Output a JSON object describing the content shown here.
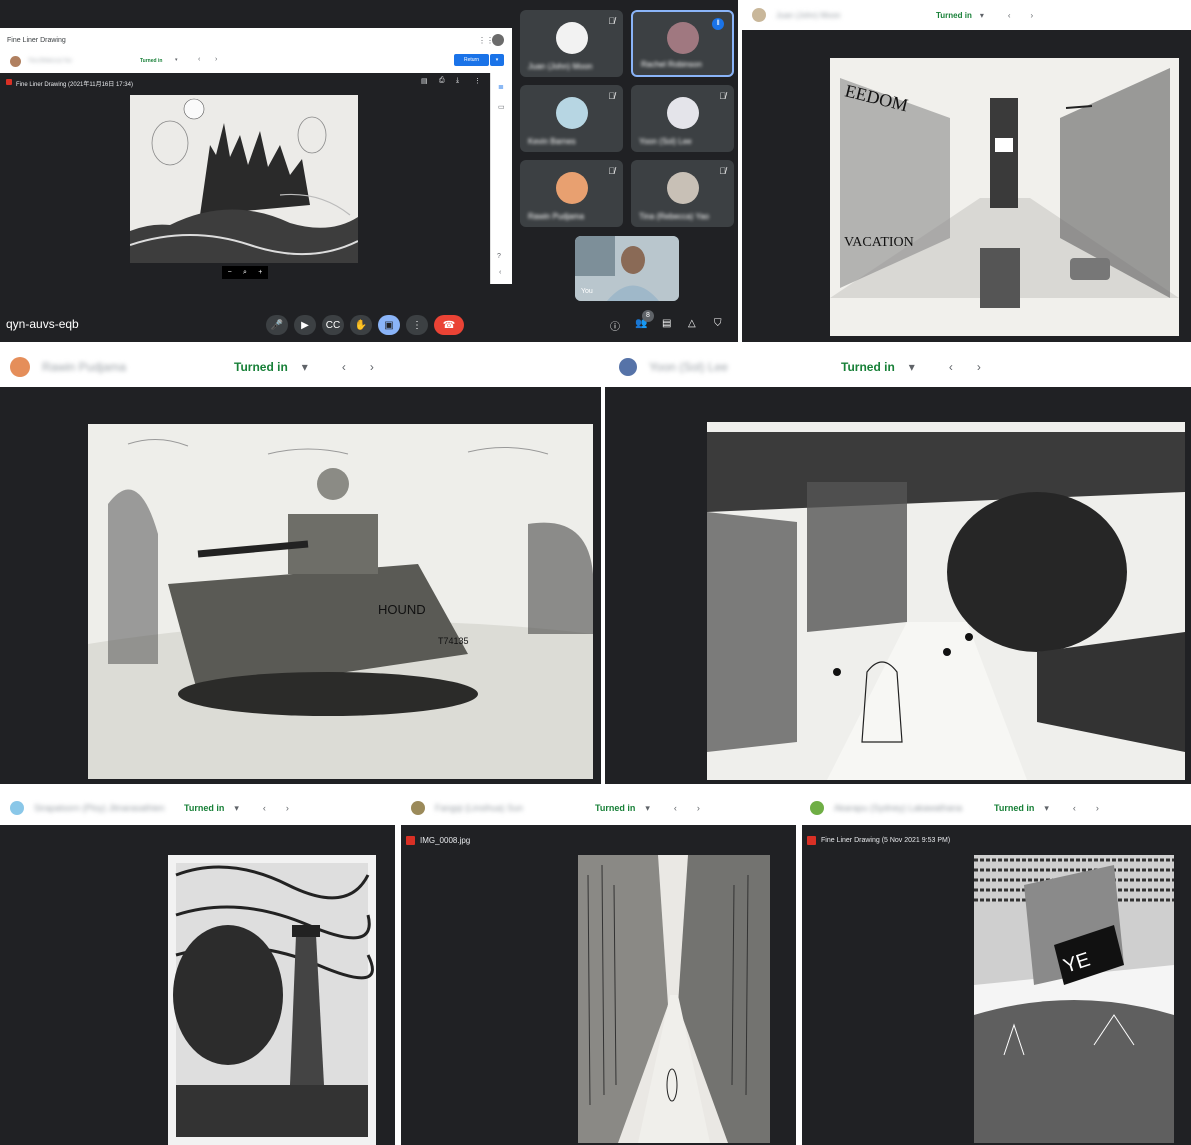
{
  "meet": {
    "meeting_code": "qyn-auvs-eqb",
    "people_count": "8",
    "self_label": "You",
    "participants": [
      {
        "name": "Juan (John) Moon"
      },
      {
        "name": "Rachel Robinson"
      },
      {
        "name": "Kevin Barnes"
      },
      {
        "name": "Yoon (Sol) Lee"
      },
      {
        "name": "Rawin Pudjama"
      },
      {
        "name": "Tina (Rebecca) Yao"
      }
    ]
  },
  "classroom": {
    "assignment_title": "Fine Liner Drawing",
    "student_name": "Tina (Rebecca) Yao",
    "status": "Turned in",
    "return_label": "Return",
    "file_name": "Fine Liner Drawing (2021年11月16日 17:34)"
  },
  "submissions": [
    {
      "student": "Juan (John) Moon",
      "status": "Turned in"
    },
    {
      "student": "Rawin Pudjama",
      "status": "Turned in"
    },
    {
      "student": "Yoon (Sol) Lee",
      "status": "Turned in"
    },
    {
      "student": "Sirapatsorn (Ploy) Jitnarasathien",
      "status": "Turned in"
    },
    {
      "student": "Fangqi (Linsihua) Sun",
      "status": "Turned in",
      "file": "IMG_0008.jpg"
    },
    {
      "student": "Akarapu (Sydney) Lakawathana",
      "status": "Turned in",
      "file": "Fine Liner Drawing (5 Nov 2021 9:53 PM)"
    }
  ],
  "colors": {
    "turned_in_green": "#188038",
    "return_blue": "#1a73e8",
    "end_call_red": "#ea4335",
    "meet_dark": "#202124"
  }
}
